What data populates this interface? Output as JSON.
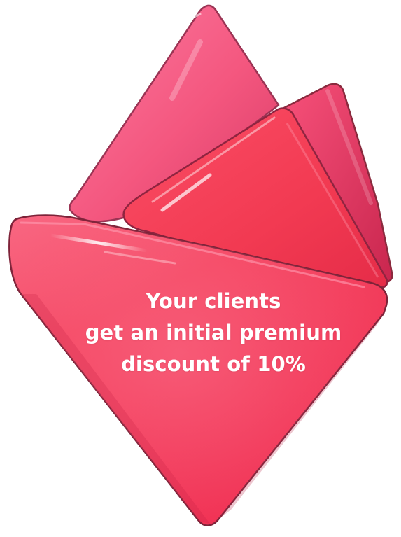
{
  "promo": {
    "lines": [
      "Your clients",
      "get an initial premium",
      "discount of 10%"
    ]
  },
  "colors": {
    "background": "#ffffff",
    "crystal_light": "#f9668f",
    "crystal_main": "#f43a5c",
    "crystal_deep": "#e0294e",
    "crystal_edge": "#8a2a3e",
    "text": "#ffffff"
  },
  "artwork": {
    "name": "faceted-red-crystal-graphic"
  }
}
